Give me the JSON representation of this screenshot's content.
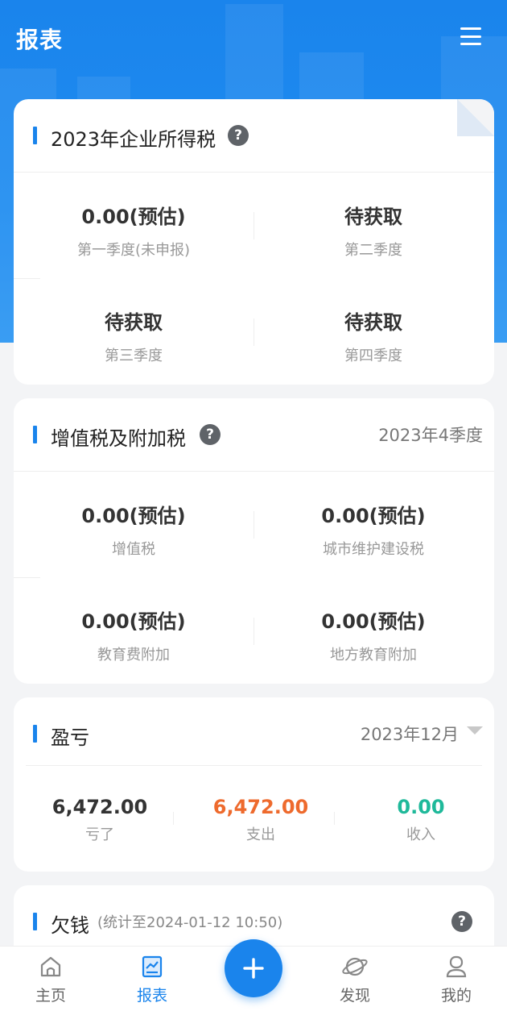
{
  "header": {
    "title": "报表"
  },
  "cit_card": {
    "title": "2023年企业所得税",
    "items": [
      {
        "value": "0.00(预估)",
        "label": "第一季度(未申报)"
      },
      {
        "value": "待获取",
        "label": "第二季度"
      },
      {
        "value": "待获取",
        "label": "第三季度"
      },
      {
        "value": "待获取",
        "label": "第四季度"
      }
    ]
  },
  "vat_card": {
    "title": "增值税及附加税",
    "period": "2023年4季度",
    "items": [
      {
        "value": "0.00(预估)",
        "label": "增值税"
      },
      {
        "value": "0.00(预估)",
        "label": "城市维护建设税"
      },
      {
        "value": "0.00(预估)",
        "label": "教育费附加"
      },
      {
        "value": "0.00(预估)",
        "label": "地方教育附加"
      }
    ]
  },
  "pl_card": {
    "title": "盈亏",
    "period": "2023年12月",
    "items": [
      {
        "value": "6,472.00",
        "label": "亏了",
        "color": "#333333"
      },
      {
        "value": "6,472.00",
        "label": "支出",
        "color": "#ee6a2d"
      },
      {
        "value": "0.00",
        "label": "收入",
        "color": "#1fb99a"
      }
    ]
  },
  "debt_card": {
    "title": "欠钱",
    "note": "(统计至2024-01-12 10:50)"
  },
  "nav": {
    "items": [
      {
        "label": "主页",
        "icon": "home-icon"
      },
      {
        "label": "报表",
        "icon": "report-icon",
        "active": true
      },
      {
        "label": "发现",
        "icon": "planet-icon"
      },
      {
        "label": "我的",
        "icon": "user-icon"
      }
    ],
    "fab_icon": "plus-icon"
  },
  "colors": {
    "primary": "#1a84ec",
    "expense": "#ee6a2d",
    "income": "#1fb99a"
  }
}
